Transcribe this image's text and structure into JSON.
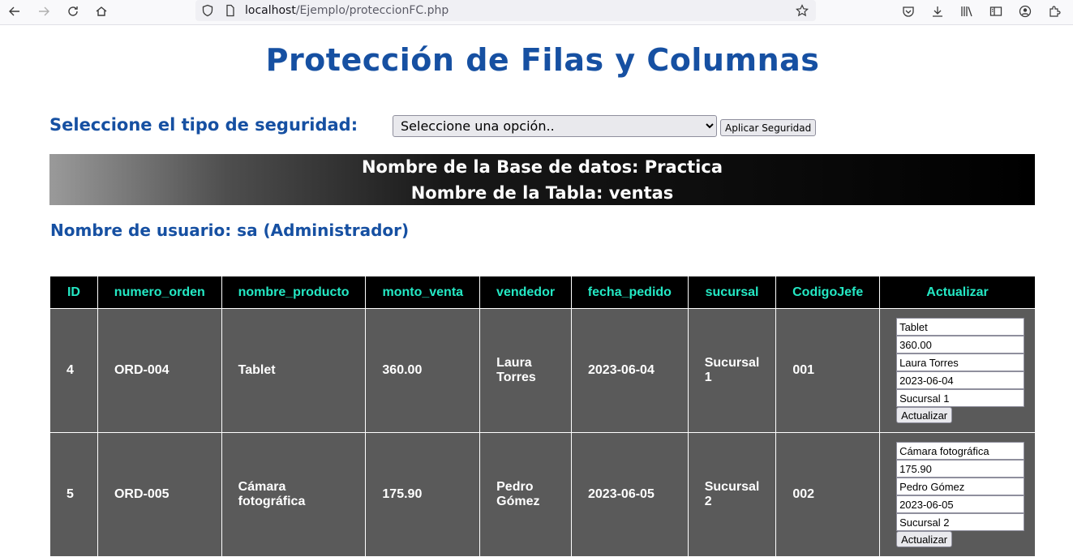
{
  "browser": {
    "url_host": "localhost",
    "url_path": "/Ejemplo/proteccionFC.php"
  },
  "page": {
    "title": "Protección de Filas y Columnas",
    "select_label": "Seleccione el tipo de seguridad:",
    "select_value": "Seleccione una opción..",
    "apply_button": "Aplicar Seguridad",
    "db_line": "Nombre de la Base de datos: Practica",
    "table_line": "Nombre de la Tabla: ventas",
    "user_line": "Nombre de usuario: sa (Administrador)"
  },
  "table": {
    "headers": [
      "ID",
      "numero_orden",
      "nombre_producto",
      "monto_venta",
      "vendedor",
      "fecha_pedido",
      "sucursal",
      "CodigoJefe",
      "Actualizar"
    ],
    "rows": [
      {
        "id": "4",
        "numero_orden": "ORD-004",
        "nombre_producto": "Tablet",
        "monto_venta": "360.00",
        "vendedor": "Laura Torres",
        "fecha_pedido": "2023-06-04",
        "sucursal": "Sucursal 1",
        "codigo_jefe": "001",
        "inputs": [
          "Tablet",
          "360.00",
          "Laura Torres",
          "2023-06-04",
          "Sucursal 1"
        ],
        "button": "Actualizar"
      },
      {
        "id": "5",
        "numero_orden": "ORD-005",
        "nombre_producto": "Cámara fotográfica",
        "monto_venta": "175.90",
        "vendedor": "Pedro Gómez",
        "fecha_pedido": "2023-06-05",
        "sucursal": "Sucursal 2",
        "codigo_jefe": "002",
        "inputs": [
          "Cámara fotográfica",
          "175.90",
          "Pedro Gómez",
          "2023-06-05",
          "Sucursal 2"
        ],
        "button": "Actualizar"
      }
    ]
  },
  "colors": {
    "title_blue": "#1650a2",
    "header_text": "#24e8c4",
    "row_bg": "#5a5a5a"
  }
}
